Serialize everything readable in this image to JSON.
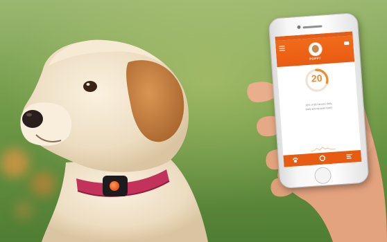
{
  "scene": {
    "description_free": true,
    "colors": {
      "background_grass": "#6f9a47",
      "dog_fur": "#efe2c8",
      "dog_ear": "#c9864a",
      "collar": "#c2325a",
      "tracker_light": "#f05a1e",
      "app_accent": "#ee6a1c"
    }
  },
  "phone_app": {
    "pet_name": "POPPY",
    "activity_value": "20",
    "info_line_1": "18% of 80 minutes daily",
    "info_line_2": "Daily activity goal nearly",
    "activity_fraction": 0.3,
    "icons": {
      "menu": "menu-icon",
      "messages": "message-icon",
      "tab_home": "paw-icon",
      "tab_activity": "activity-ring-icon",
      "tab_stats": "stats-icon"
    }
  }
}
